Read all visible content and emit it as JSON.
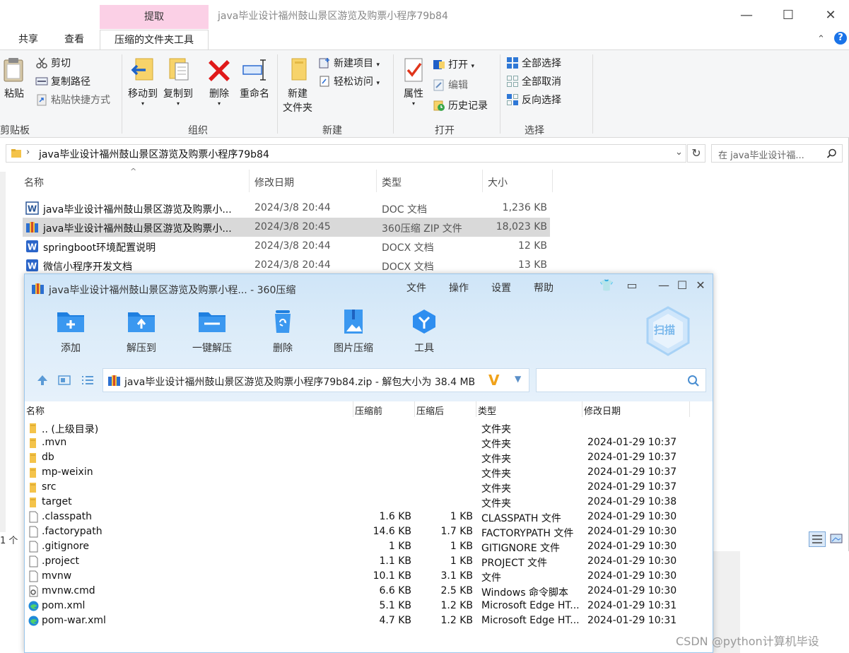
{
  "explorer": {
    "context_tab_top": "提取",
    "title": "java毕业设计福州鼓山景区游览及购票小程序79b84",
    "tabs": [
      "共享",
      "查看",
      "压缩的文件夹工具"
    ],
    "ribbon": {
      "clipboard": {
        "paste": "粘贴",
        "cut": "剪切",
        "copy_path": "复制路径",
        "paste_shortcut": "粘贴快捷方式",
        "label": "剪贴板"
      },
      "organize": {
        "move_to": "移动到",
        "copy_to": "复制到",
        "delete": "删除",
        "rename": "重命名",
        "label": "组织"
      },
      "new": {
        "new_folder": "新建\n文件夹",
        "new_item": "新建项目",
        "easy_access": "轻松访问",
        "label": "新建"
      },
      "open": {
        "properties": "属性",
        "open": "打开",
        "edit": "编辑",
        "history": "历史记录",
        "label": "打开"
      },
      "select": {
        "select_all": "全部选择",
        "select_none": "全部取消",
        "invert": "反向选择",
        "label": "选择"
      }
    },
    "address": "java毕业设计福州鼓山景区游览及购票小程序79b84",
    "search_placeholder": "在 java毕业设计福...",
    "columns": {
      "name": "名称",
      "date": "修改日期",
      "type": "类型",
      "size": "大小"
    },
    "files": [
      {
        "name": "java毕业设计福州鼓山景区游览及购票小...",
        "date": "2024/3/8 20:44",
        "type": "DOC 文档",
        "size": "1,236 KB",
        "icon": "word-icon"
      },
      {
        "name": "java毕业设计福州鼓山景区游览及购票小...",
        "date": "2024/3/8 20:45",
        "type": "360压缩 ZIP 文件",
        "size": "18,023 KB",
        "icon": "zip-icon"
      },
      {
        "name": "springboot环境配置说明",
        "date": "2024/3/8 20:44",
        "type": "DOCX 文档",
        "size": "12 KB",
        "icon": "word-icon"
      },
      {
        "name": "微信小程序开发文档",
        "date": "2024/3/8 20:44",
        "type": "DOCX 文档",
        "size": "13 KB",
        "icon": "word-icon"
      }
    ],
    "status": "1 个"
  },
  "zip": {
    "title": "java毕业设计福州鼓山景区游览及购票小程... - 360压缩",
    "menu": [
      "文件",
      "操作",
      "设置",
      "帮助"
    ],
    "toolbar": [
      "添加",
      "解压到",
      "一键解压",
      "删除",
      "图片压缩",
      "工具"
    ],
    "scan": "扫描",
    "address": "java毕业设计福州鼓山景区游览及购票小程序79b84.zip - 解包大小为 38.4 MB",
    "columns": {
      "name": "名称",
      "before": "压缩前",
      "after": "压缩后",
      "type": "类型",
      "date": "修改日期"
    },
    "entries": [
      {
        "name": ".. (上级目录)",
        "before": "",
        "after": "",
        "type": "文件夹",
        "date": "",
        "kind": "folder"
      },
      {
        "name": ".mvn",
        "before": "",
        "after": "",
        "type": "文件夹",
        "date": "2024-01-29 10:37",
        "kind": "folder"
      },
      {
        "name": "db",
        "before": "",
        "after": "",
        "type": "文件夹",
        "date": "2024-01-29 10:37",
        "kind": "folder"
      },
      {
        "name": "mp-weixin",
        "before": "",
        "after": "",
        "type": "文件夹",
        "date": "2024-01-29 10:37",
        "kind": "folder"
      },
      {
        "name": "src",
        "before": "",
        "after": "",
        "type": "文件夹",
        "date": "2024-01-29 10:37",
        "kind": "folder"
      },
      {
        "name": "target",
        "before": "",
        "after": "",
        "type": "文件夹",
        "date": "2024-01-29 10:38",
        "kind": "folder"
      },
      {
        "name": ".classpath",
        "before": "1.6 KB",
        "after": "1 KB",
        "type": "CLASSPATH 文件",
        "date": "2024-01-29 10:30",
        "kind": "file"
      },
      {
        "name": ".factorypath",
        "before": "14.6 KB",
        "after": "1.7 KB",
        "type": "FACTORYPATH 文件",
        "date": "2024-01-29 10:30",
        "kind": "file"
      },
      {
        "name": ".gitignore",
        "before": "1 KB",
        "after": "1 KB",
        "type": "GITIGNORE 文件",
        "date": "2024-01-29 10:30",
        "kind": "file"
      },
      {
        "name": ".project",
        "before": "1.1 KB",
        "after": "1 KB",
        "type": "PROJECT 文件",
        "date": "2024-01-29 10:30",
        "kind": "file"
      },
      {
        "name": "mvnw",
        "before": "10.1 KB",
        "after": "3.1 KB",
        "type": "文件",
        "date": "2024-01-29 10:30",
        "kind": "file"
      },
      {
        "name": "mvnw.cmd",
        "before": "6.6 KB",
        "after": "2.5 KB",
        "type": "Windows 命令脚本",
        "date": "2024-01-29 10:30",
        "kind": "cmd"
      },
      {
        "name": "pom.xml",
        "before": "5.1 KB",
        "after": "1.2 KB",
        "type": "Microsoft Edge HT...",
        "date": "2024-01-29 10:31",
        "kind": "edge"
      },
      {
        "name": "pom-war.xml",
        "before": "4.7 KB",
        "after": "1.2 KB",
        "type": "Microsoft Edge HT...",
        "date": "2024-01-29 10:31",
        "kind": "edge"
      }
    ]
  },
  "watermark": "CSDN @python计算机毕设"
}
